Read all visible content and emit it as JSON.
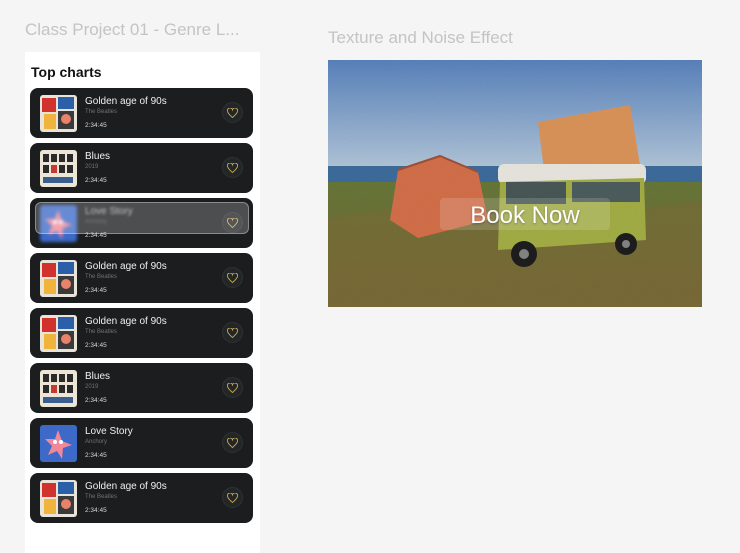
{
  "canvas": {
    "frame1_label": "Class Project 01 - Genre L...",
    "frame2_label": "Texture and Noise Effect"
  },
  "top_charts": {
    "title": "Top charts",
    "items": [
      {
        "title": "Golden age of 90s",
        "artist": "The Beatles",
        "duration": "2:34:45",
        "art": "collage-icon"
      },
      {
        "title": "Blues",
        "artist": "2019",
        "duration": "2:34:45",
        "art": "grid-icon"
      },
      {
        "title": "Love Story",
        "artist": "Anchory",
        "duration": "2:34:45",
        "art": "starfish-icon",
        "state": "dragging"
      },
      {
        "title": "Golden age of 90s",
        "artist": "The Beatles",
        "duration": "2:34:45",
        "art": "collage-icon"
      },
      {
        "title": "Golden age of 90s",
        "artist": "The Beatles",
        "duration": "2:34:45",
        "art": "collage-icon"
      },
      {
        "title": "Blues",
        "artist": "2019",
        "duration": "2:34:45",
        "art": "grid-icon"
      },
      {
        "title": "Love Story",
        "artist": "Anchory",
        "duration": "2:34:45",
        "art": "starfish-icon"
      },
      {
        "title": "Golden age of 90s",
        "artist": "The Beatles",
        "duration": "2:34:45",
        "art": "collage-icon"
      }
    ]
  },
  "hero": {
    "button_label": "Book Now"
  },
  "colors": {
    "card_bg": "#1b1d1e",
    "heart": "#c8a85a"
  }
}
